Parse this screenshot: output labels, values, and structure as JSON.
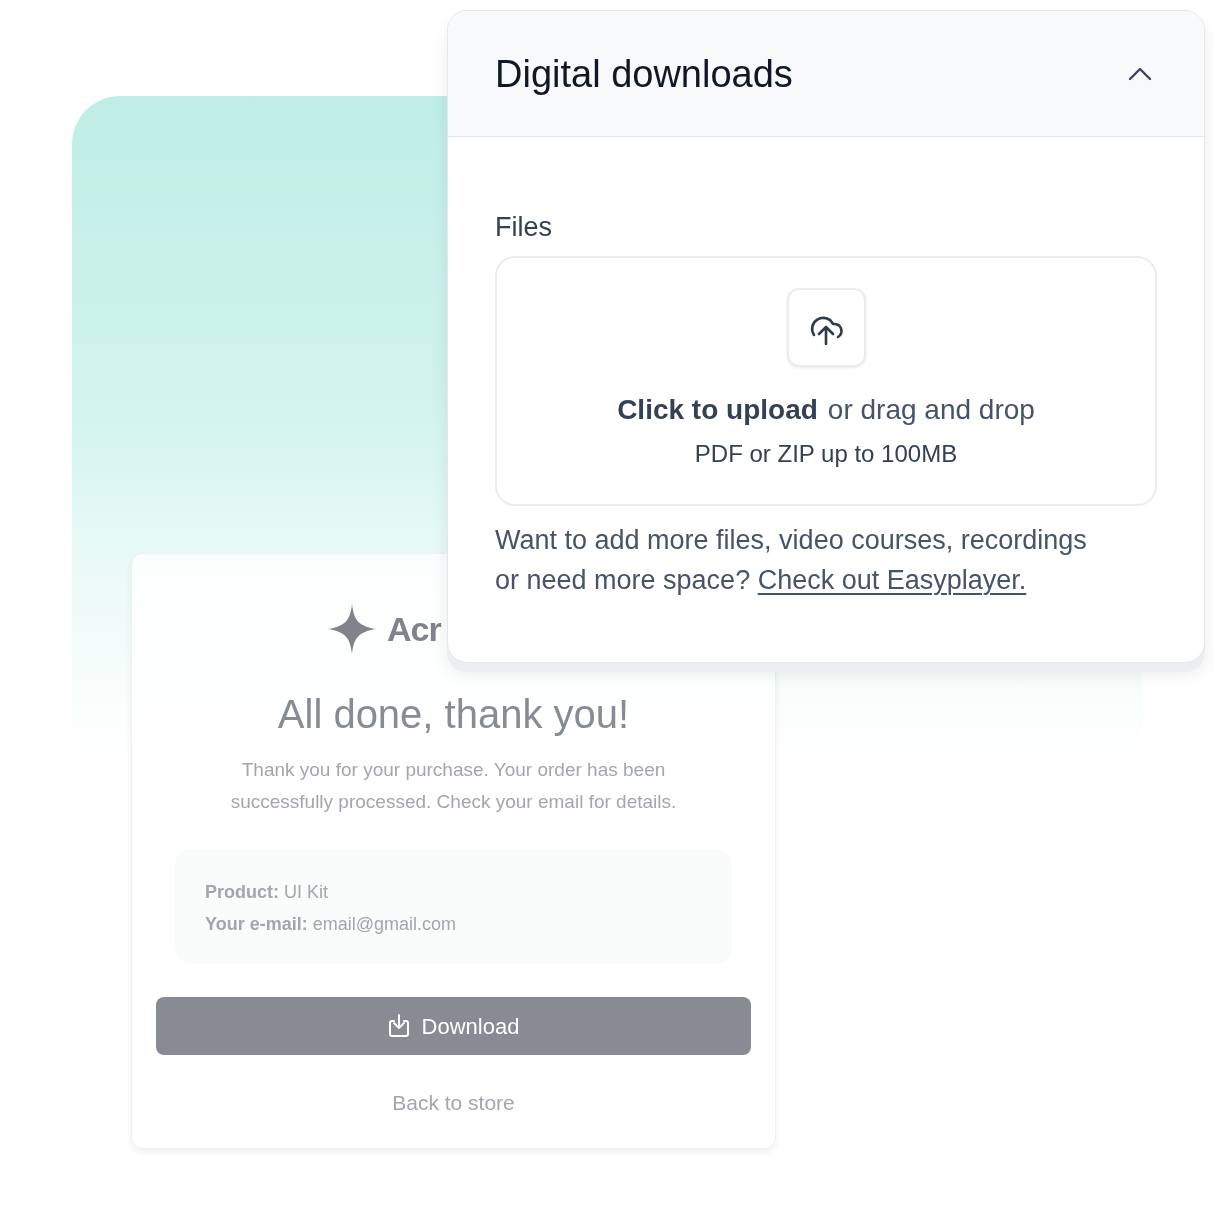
{
  "confirmation_card": {
    "logo_text": "Acr",
    "heading": "All done, thank you!",
    "message": "Thank you for your purchase. Your order has been successfully processed. Check your email for details.",
    "details": [
      "**Product:** UI Kit",
      "**Your e-mail:** email@gmail.com"
    ],
    "download_button": "Download",
    "back_link": "Back to store"
  },
  "downloads_panel": {
    "title": "Digital downloads",
    "expanded": true,
    "files_label": "Files",
    "upload": {
      "action": "Click to upload",
      "hint": "or drag and drop",
      "formats": "PDF or ZIP up to 100MB"
    },
    "note": "Want to add more files, video courses, recordings or need more space?",
    "note_link": "Check out Easyplayer."
  }
}
